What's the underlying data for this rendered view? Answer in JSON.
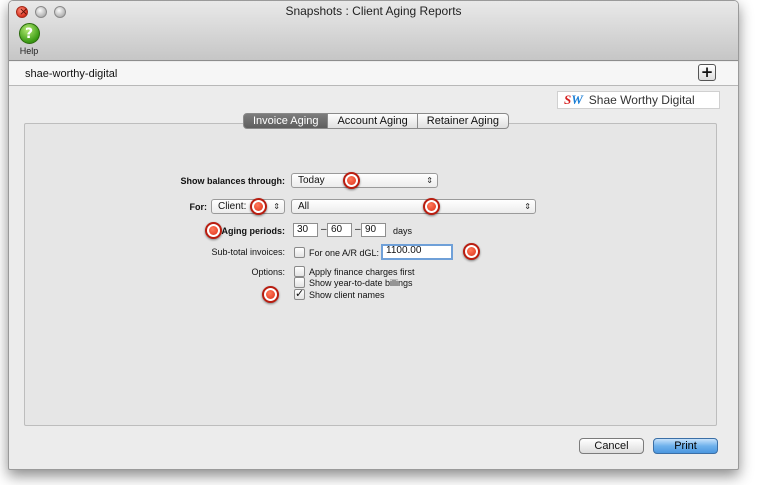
{
  "window": {
    "title": "Snapshots : Client Aging Reports"
  },
  "toolbar": {
    "help_label": "Help",
    "help_glyph": "?"
  },
  "header": {
    "client_name": "shae-worthy-digital",
    "add_glyph": "+"
  },
  "logo": {
    "mark_s": "S",
    "mark_w": "W",
    "text": "Shae Worthy Digital"
  },
  "tabs": [
    {
      "label": "Invoice Aging",
      "active": true
    },
    {
      "label": "Account Aging",
      "active": false
    },
    {
      "label": "Retainer Aging",
      "active": false
    }
  ],
  "form": {
    "show_balances_label": "Show balances through:",
    "show_balances_value": "Today",
    "for_label": "For:",
    "for_type_value": "Client:",
    "for_target_value": "All",
    "aging_periods_label": "Aging periods:",
    "aging_periods": [
      "30",
      "60",
      "90"
    ],
    "aging_separator": "–",
    "aging_unit": "days",
    "subtotal_label": "Sub-total invoices:",
    "subtotal_checkbox_label": "For one A/R dGL:",
    "subtotal_value": "1100.00",
    "options_label": "Options:",
    "options": [
      {
        "label": "Apply finance charges first",
        "checked": false
      },
      {
        "label": "Show year-to-date billings",
        "checked": false
      },
      {
        "label": "Show client names",
        "checked": true
      }
    ]
  },
  "buttons": {
    "cancel": "Cancel",
    "print": "Print"
  },
  "colors": {
    "marker_red": "#e03017",
    "primary_blue": "#5da4e6",
    "tab_active": "#6a6a6a"
  }
}
